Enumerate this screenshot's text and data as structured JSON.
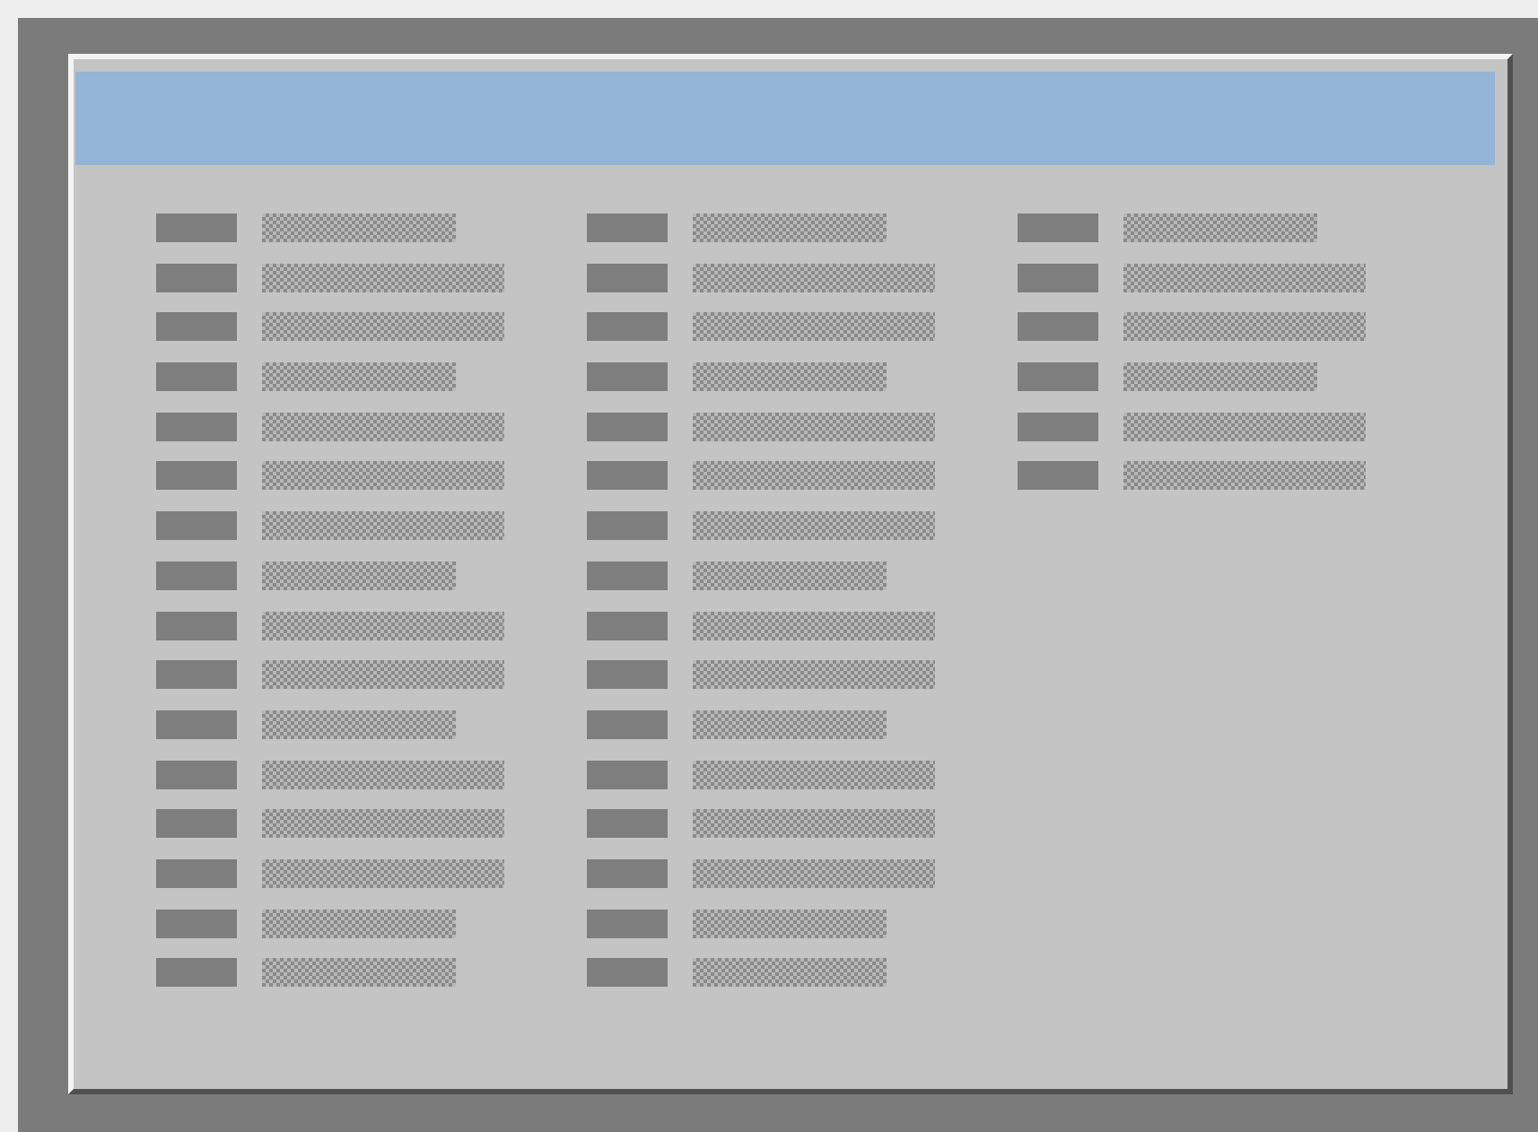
{
  "window": {
    "columns": [
      {
        "items": [
          {
            "kind": "short"
          },
          {
            "kind": "long"
          },
          {
            "kind": "long"
          },
          {
            "kind": "short"
          },
          {
            "kind": "long"
          },
          {
            "kind": "long"
          },
          {
            "kind": "long"
          },
          {
            "kind": "short"
          },
          {
            "kind": "long"
          },
          {
            "kind": "long"
          },
          {
            "kind": "short"
          },
          {
            "kind": "long"
          },
          {
            "kind": "long"
          },
          {
            "kind": "long"
          },
          {
            "kind": "short"
          },
          {
            "kind": "short"
          }
        ]
      },
      {
        "items": [
          {
            "kind": "short"
          },
          {
            "kind": "long"
          },
          {
            "kind": "long"
          },
          {
            "kind": "short"
          },
          {
            "kind": "long"
          },
          {
            "kind": "long"
          },
          {
            "kind": "long"
          },
          {
            "kind": "short"
          },
          {
            "kind": "long"
          },
          {
            "kind": "long"
          },
          {
            "kind": "short"
          },
          {
            "kind": "long"
          },
          {
            "kind": "long"
          },
          {
            "kind": "long"
          },
          {
            "kind": "short"
          },
          {
            "kind": "short"
          }
        ]
      },
      {
        "items": [
          {
            "kind": "short"
          },
          {
            "kind": "long"
          },
          {
            "kind": "long"
          },
          {
            "kind": "short"
          },
          {
            "kind": "long"
          },
          {
            "kind": "long"
          }
        ]
      }
    ]
  }
}
